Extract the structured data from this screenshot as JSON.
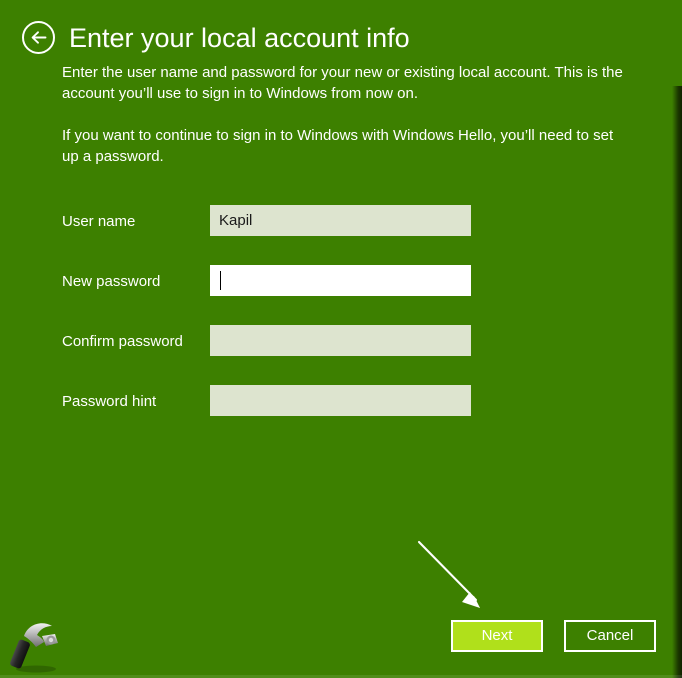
{
  "window": {
    "background_color": "#3d8000",
    "accent_color": "#b0e01b"
  },
  "header": {
    "back_label": "Back",
    "title": "Enter your local account info"
  },
  "intro": {
    "paragraph1": "Enter the user name and password for your new or existing local account. This is the account you’ll use to sign in to Windows from now on.",
    "paragraph2": "If you want to continue to sign in to Windows with Windows Hello, you’ll need to set up a password."
  },
  "form": {
    "fields": [
      {
        "label": "User name",
        "value": "Kapil",
        "placeholder": "",
        "type": "text",
        "focused": false
      },
      {
        "label": "New password",
        "value": "",
        "placeholder": "",
        "type": "password",
        "focused": true
      },
      {
        "label": "Confirm password",
        "value": "",
        "placeholder": "",
        "type": "password",
        "focused": false
      },
      {
        "label": "Password hint",
        "value": "",
        "placeholder": "",
        "type": "text",
        "focused": false
      }
    ]
  },
  "footer": {
    "next_label": "Next",
    "cancel_label": "Cancel"
  },
  "annotation": {
    "arrow": "arrow pointing to Next button"
  },
  "watermark": {
    "icon": "hammer-icon"
  }
}
